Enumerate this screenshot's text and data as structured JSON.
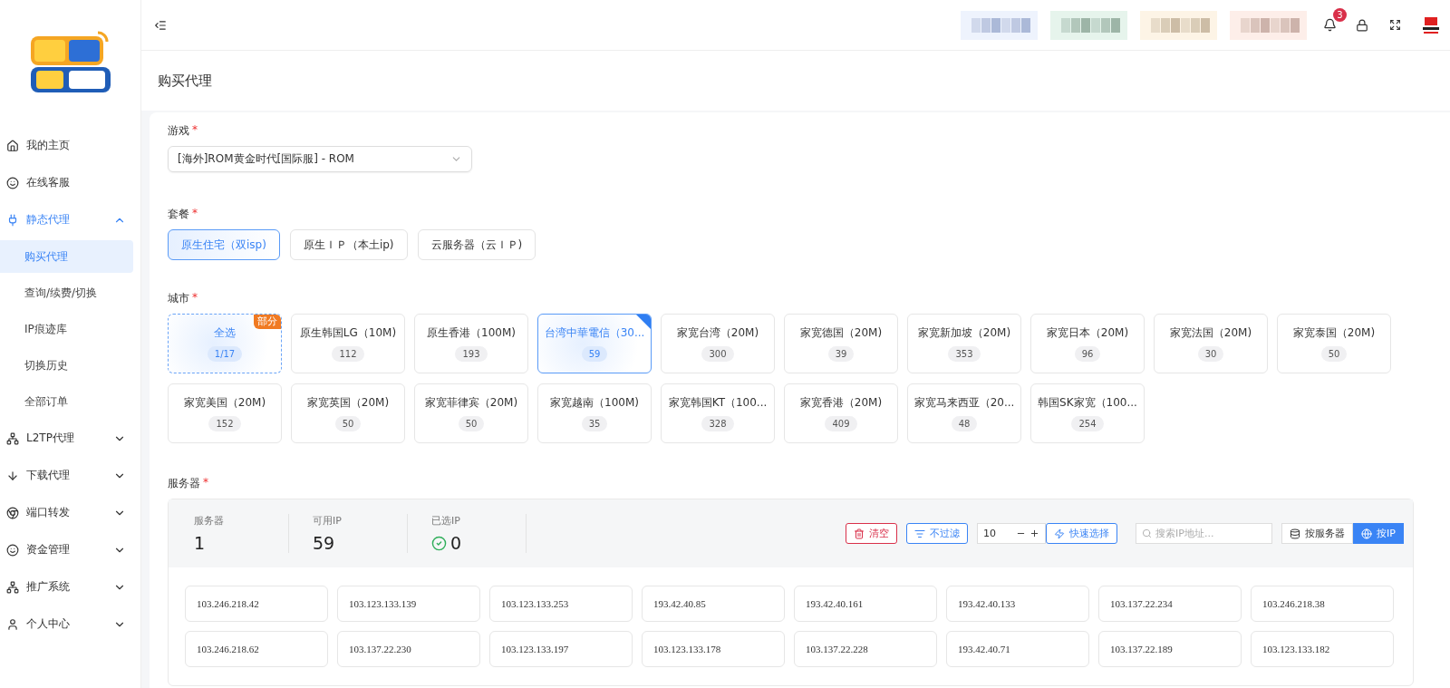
{
  "header": {
    "notifications": "3"
  },
  "sidebar": {
    "items": [
      {
        "label": "我的主页",
        "kind": "home"
      },
      {
        "label": "在线客服",
        "kind": "face"
      },
      {
        "label": "静态代理",
        "kind": "plug",
        "expanded": true,
        "children": [
          {
            "label": "购买代理",
            "selected": true
          },
          {
            "label": "查询/续费/切换",
            "selected": false
          },
          {
            "label": "IP痕迹库",
            "selected": false
          },
          {
            "label": "切换历史",
            "selected": false
          },
          {
            "label": "全部订单",
            "selected": false
          }
        ]
      },
      {
        "label": "L2TP代理",
        "kind": "network",
        "expanded": false
      },
      {
        "label": "下载代理",
        "kind": "down",
        "expanded": false
      },
      {
        "label": "端口转发",
        "kind": "chrome",
        "expanded": false
      },
      {
        "label": "资金管理",
        "kind": "face",
        "expanded": false
      },
      {
        "label": "推广系统",
        "kind": "network",
        "expanded": false
      },
      {
        "label": "个人中心",
        "kind": "user",
        "expanded": false
      }
    ]
  },
  "page_title": "购买代理",
  "game": {
    "label": "游戏",
    "required_mark": "*",
    "value": "[海外]ROM黄金时代[国际服] - ROM"
  },
  "plan": {
    "label": "套餐",
    "required_mark": "*",
    "options": [
      {
        "label": "原生住宅（双isp)",
        "selected": true
      },
      {
        "label": "原生ＩＰ（本土ip)",
        "selected": false
      },
      {
        "label": "云服务器（云ＩＰ)",
        "selected": false
      }
    ]
  },
  "city": {
    "label": "城市",
    "required_mark": "*",
    "items": [
      {
        "kind": "all",
        "label": "全选",
        "count": "1/17",
        "badge": "部分",
        "selected": false
      },
      {
        "kind": "city",
        "label": "原生韩国LG（10M)",
        "count": "112",
        "selected": false
      },
      {
        "kind": "city",
        "label": "原生香港（100M)",
        "count": "193",
        "selected": false
      },
      {
        "kind": "city",
        "label": "台湾中華電信（30...",
        "count": "59",
        "selected": true
      },
      {
        "kind": "city",
        "label": "家宽台湾（20M)",
        "count": "300",
        "selected": false
      },
      {
        "kind": "city",
        "label": "家宽德国（20M)",
        "count": "39",
        "selected": false
      },
      {
        "kind": "city",
        "label": "家宽新加坡（20M)",
        "count": "353",
        "selected": false
      },
      {
        "kind": "city",
        "label": "家宽日本（20M)",
        "count": "96",
        "selected": false
      },
      {
        "kind": "city",
        "label": "家宽法国（20M)",
        "count": "30",
        "selected": false
      },
      {
        "kind": "city",
        "label": "家宽泰国（20M)",
        "count": "50",
        "selected": false
      },
      {
        "kind": "city",
        "label": "家宽美国（20M)",
        "count": "152",
        "selected": false
      },
      {
        "kind": "city",
        "label": "家宽英国（20M)",
        "count": "50",
        "selected": false
      },
      {
        "kind": "city",
        "label": "家宽菲律宾（20M)",
        "count": "50",
        "selected": false
      },
      {
        "kind": "city",
        "label": "家宽越南（100M)",
        "count": "35",
        "selected": false
      },
      {
        "kind": "city",
        "label": "家宽韩国KT（100...",
        "count": "328",
        "selected": false
      },
      {
        "kind": "city",
        "label": "家宽香港（20M)",
        "count": "409",
        "selected": false
      },
      {
        "kind": "city",
        "label": "家宽马来西亚（20...",
        "count": "48",
        "selected": false
      },
      {
        "kind": "city",
        "label": "韩国SK家宽（100...",
        "count": "254",
        "selected": false
      }
    ]
  },
  "server": {
    "label": "服务器",
    "required_mark": "*",
    "stats": [
      {
        "kind": "plain",
        "label": "服务器",
        "value": "1"
      },
      {
        "kind": "plain",
        "label": "可用IP",
        "value": "59"
      },
      {
        "kind": "check",
        "label": "已选IP",
        "value": "0"
      }
    ],
    "clear_button": "清空",
    "filter_button": "不过滤",
    "quantity": "10",
    "quick_select_button": "快速选择",
    "search": {
      "placeholder": "搜索IP地址..."
    },
    "view_modes": [
      {
        "label": "按服务器",
        "kind": "database",
        "selected": false
      },
      {
        "label": "按IP",
        "kind": "globe",
        "selected": true
      }
    ],
    "ips": [
      "103.246.218.42",
      "103.123.133.139",
      "103.123.133.253",
      "193.42.40.85",
      "193.42.40.161",
      "193.42.40.133",
      "103.137.22.234",
      "103.246.218.38",
      "103.246.218.62",
      "103.137.22.230",
      "103.123.133.197",
      "103.123.133.178",
      "103.137.22.228",
      "193.42.40.71",
      "103.137.22.189",
      "103.123.133.182"
    ]
  }
}
